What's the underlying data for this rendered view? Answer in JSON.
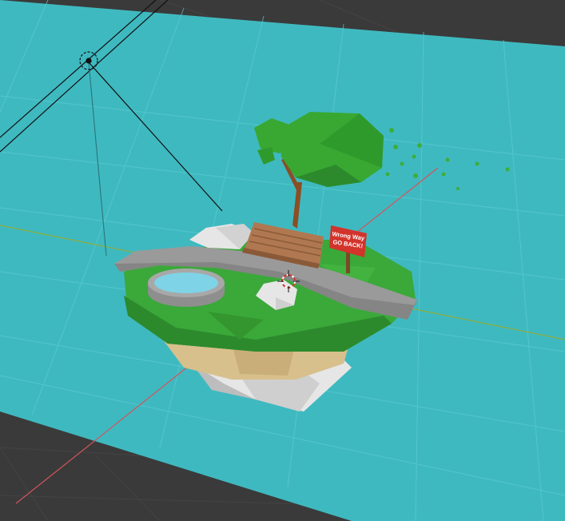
{
  "scene": {
    "sign": {
      "line1": "Wrong Way",
      "line2": "GO BACK!"
    }
  },
  "colors": {
    "viewport_bg": "#3a3a3a",
    "ground_plane": "#3fb9c0",
    "grid_line": "#5ccbd1",
    "x_axis": "#d4545c",
    "y_axis": "#8fae3a",
    "grass": "#3ba83a",
    "grass_dark": "#2c8a2d",
    "soil": "#d8c08c",
    "rock": "#e6e6e6",
    "path": "#9a9a9a",
    "water": "#7fd3e6",
    "bench": "#b07850",
    "tree_trunk": "#8a4f25",
    "foliage": "#38a832",
    "sign_board": "#d2342c",
    "sign_post": "#7a4a26"
  },
  "objects": [
    "floating-island",
    "tree",
    "bench",
    "sign",
    "stone-well",
    "path",
    "rocks",
    "camera",
    "3d-cursor"
  ]
}
